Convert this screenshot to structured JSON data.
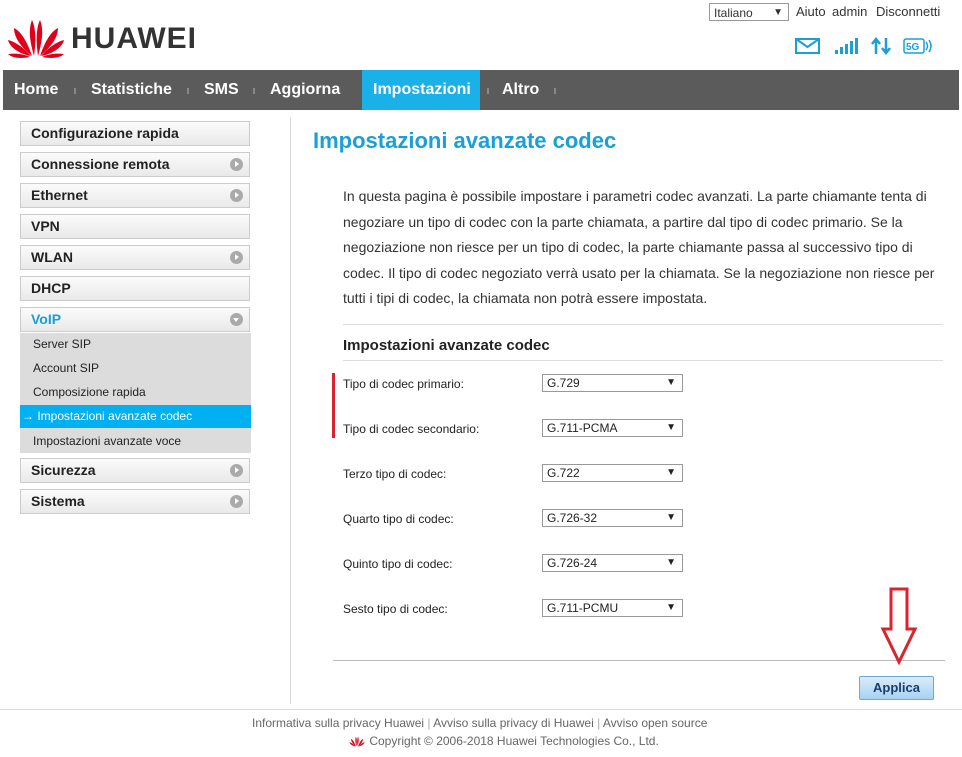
{
  "brand": {
    "name": "HUAWEI",
    "color": "#e1001a"
  },
  "top": {
    "language": "Italiano",
    "help": "Aiuto",
    "user": "admin",
    "logout": "Disconnetti"
  },
  "status_icons": [
    "mail-icon",
    "signal-icon",
    "data-arrows-icon",
    "5g-icon"
  ],
  "nav": [
    "Home",
    "Statistiche",
    "SMS",
    "Aggiorna",
    "Impostazioni",
    "Altro"
  ],
  "sidebar": {
    "items": [
      "Configurazione rapida",
      "Connessione remota",
      "Ethernet",
      "VPN",
      "WLAN",
      "DHCP",
      "VoIP",
      "Sicurezza",
      "Sistema"
    ],
    "voip_sub": [
      "Server SIP",
      "Account SIP",
      "Composizione rapida",
      "→ Impostazioni avanzate codec",
      "Impostazioni avanzate voce"
    ]
  },
  "page": {
    "title": "Impostazioni avanzate codec",
    "description": "In questa pagina è possibile impostare i parametri codec avanzati. La parte chiamante tenta di negoziare un tipo di codec con la parte chiamata, a partire dal tipo di codec primario. Se la negoziazione non riesce per un tipo di codec, la parte chiamante passa al successivo tipo di codec. Il tipo di codec negoziato verrà usato per la chiamata. Se la negoziazione non riesce per tutti i tipi di codec, la chiamata non potrà essere impostata.",
    "section_title": "Impostazioni avanzate codec",
    "fields": [
      {
        "label": "Tipo di codec primario:",
        "value": "G.729"
      },
      {
        "label": "Tipo di codec secondario:",
        "value": "G.711-PCMA"
      },
      {
        "label": "Terzo tipo di codec:",
        "value": "G.722"
      },
      {
        "label": "Quarto tipo di codec:",
        "value": "G.726-32"
      },
      {
        "label": "Quinto tipo di codec:",
        "value": "G.726-24"
      },
      {
        "label": "Sesto tipo di codec:",
        "value": "G.711-PCMU"
      }
    ],
    "apply": "Applica"
  },
  "footer": {
    "links": [
      "Informativa sulla privacy Huawei",
      "Avviso sulla privacy di Huawei",
      "Avviso open source"
    ],
    "copyright": "Copyright © 2006-2018 Huawei Technologies Co., Ltd."
  },
  "colors": {
    "accent": "#1ab0e8",
    "nav": "#5b5b5b",
    "highlight": "#d9232e"
  }
}
